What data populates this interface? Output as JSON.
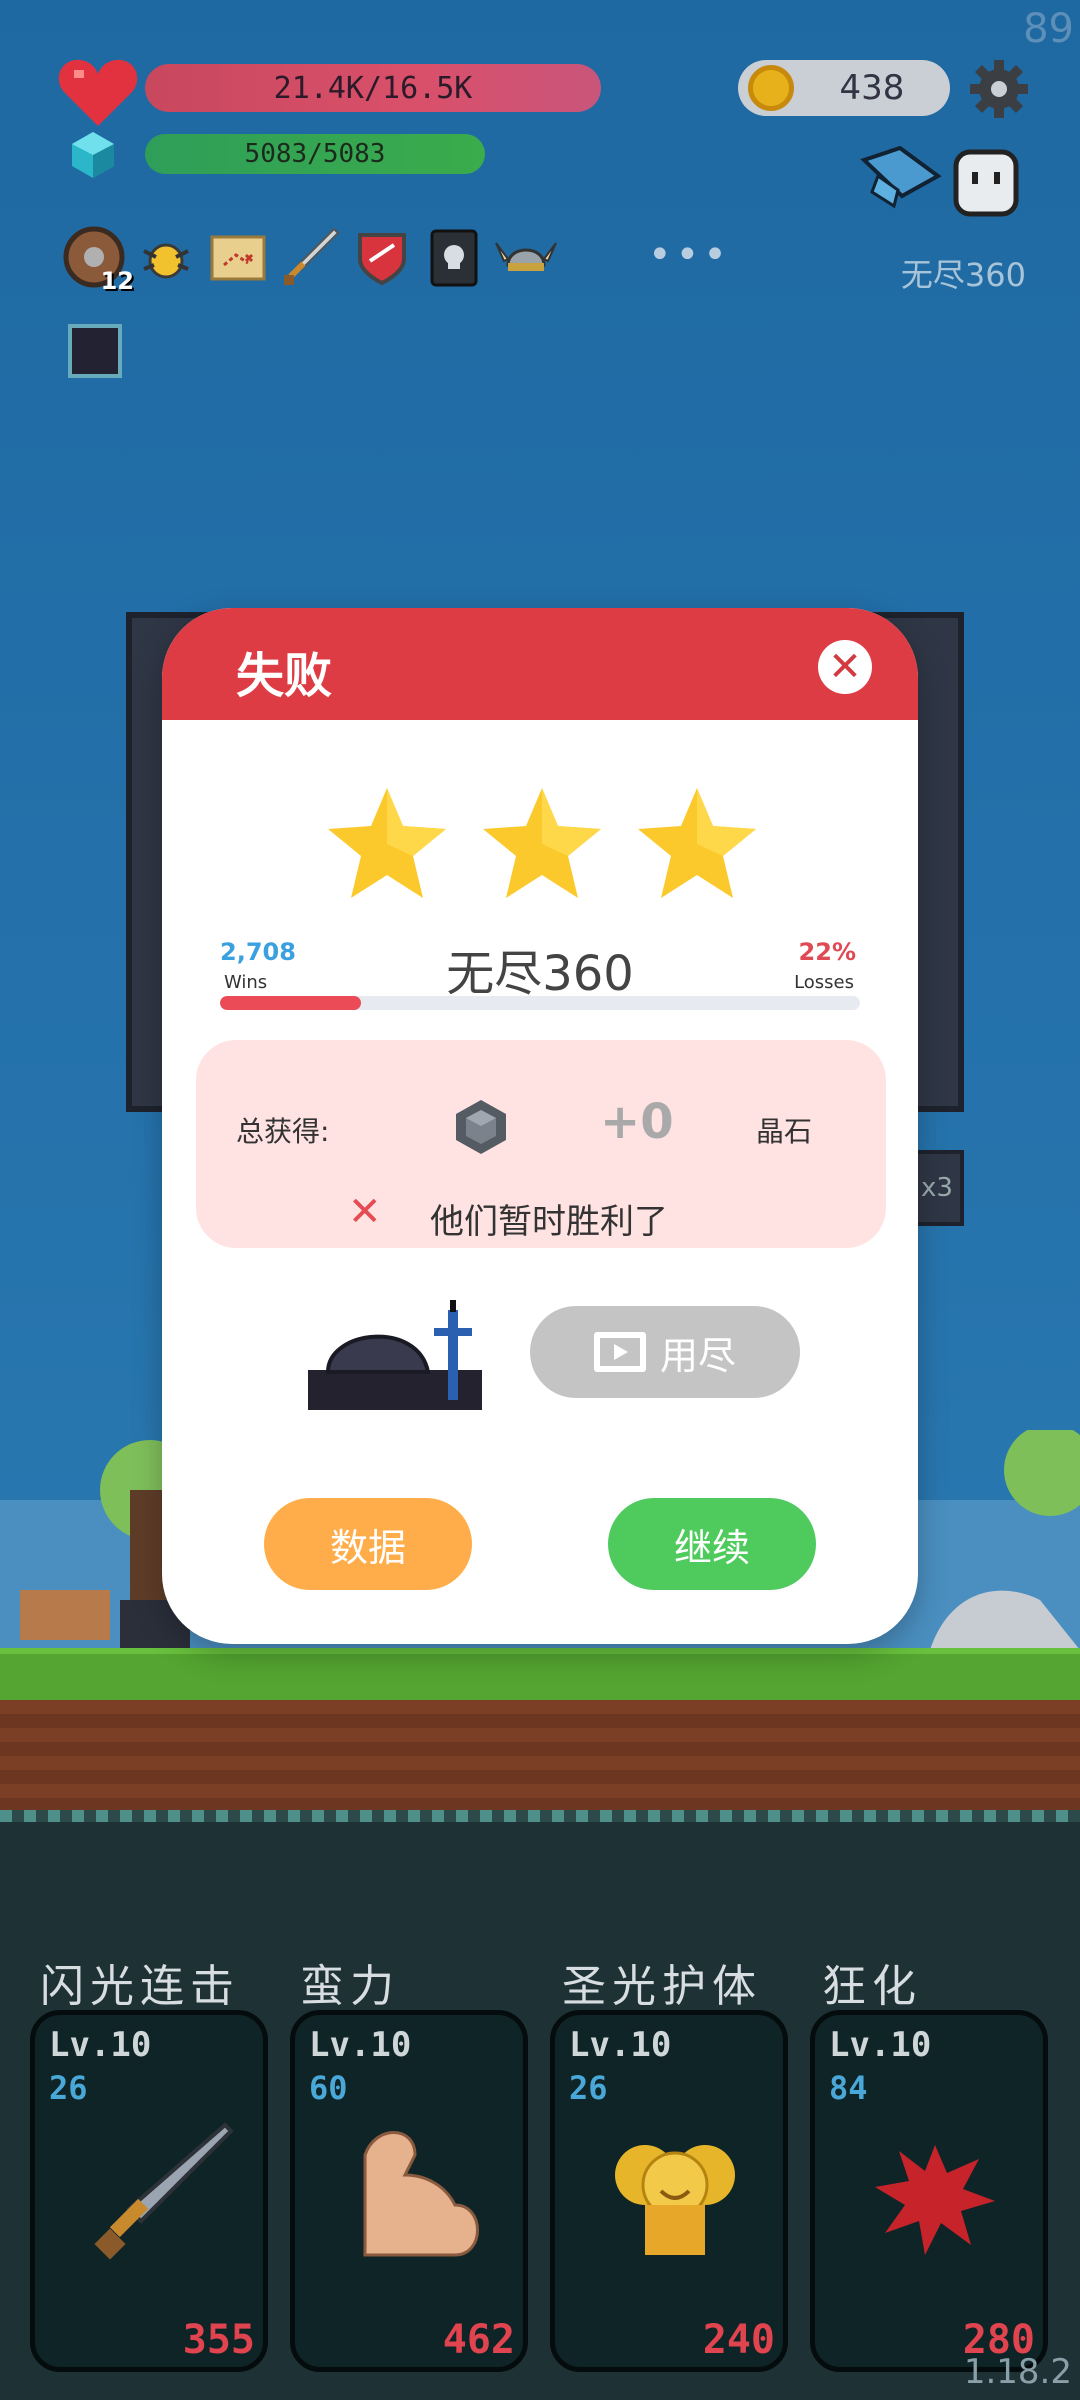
{
  "hud": {
    "fps": "89",
    "hp_text": "21.4K/16.5K",
    "energy_text": "5083/5083",
    "coins": "438",
    "mode_label": "无尽360",
    "item_badge": "12",
    "more": "•••",
    "x3_tag": "x3",
    "version": "1.18.2"
  },
  "modal": {
    "title": "失败",
    "close": "✕",
    "stars": 3,
    "wins_value": "2,708",
    "wins_label": "Wins",
    "losses_value": "22%",
    "losses_label": "Losses",
    "losses_fraction": 0.22,
    "mode_title": "无尽360",
    "reward_label": "总获得:",
    "reward_amount": "+0",
    "reward_unit": "晶石",
    "fail_icon": "✕",
    "fail_message": "他们暂时胜利了",
    "ad_button_label": "用尽",
    "data_button": "数据",
    "continue_button": "继续"
  },
  "skills": [
    {
      "name": "闪光连击",
      "level": "Lv.10",
      "value": "26",
      "cost": "355",
      "icon": "sword-icon"
    },
    {
      "name": "蛮力",
      "level": "Lv.10",
      "value": "60",
      "cost": "462",
      "icon": "muscle-icon"
    },
    {
      "name": "圣光护体",
      "level": "Lv.10",
      "value": "26",
      "cost": "240",
      "icon": "holy-shield-icon"
    },
    {
      "name": "狂化",
      "level": "Lv.10",
      "value": "84",
      "cost": "280",
      "icon": "rage-splat-icon"
    }
  ],
  "colors": {
    "header_red": "#de3c44",
    "continue_green": "#4fcb5e",
    "data_orange": "#ffad4a",
    "star_yellow": "#fcc92c"
  }
}
